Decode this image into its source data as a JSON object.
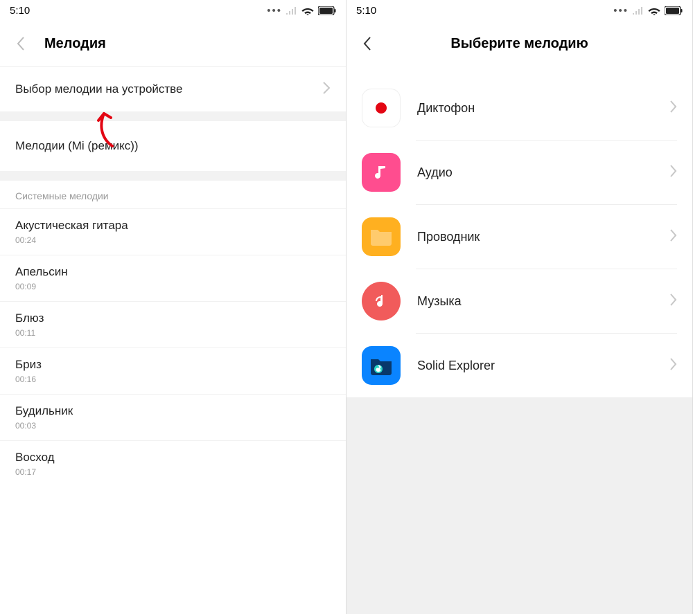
{
  "statusbar": {
    "time": "5:10"
  },
  "left": {
    "title": "Мелодия",
    "select_device": "Выбор мелодии на устройстве",
    "current": "Мелодии (Mi (ремикс))",
    "section_header": "Системные мелодии",
    "ringtones": [
      {
        "name": "Акустическая гитара",
        "duration": "00:24"
      },
      {
        "name": "Апельсин",
        "duration": "00:09"
      },
      {
        "name": "Блюз",
        "duration": "00:11"
      },
      {
        "name": "Бриз",
        "duration": "00:16"
      },
      {
        "name": "Будильник",
        "duration": "00:03"
      },
      {
        "name": "Восход",
        "duration": "00:17"
      }
    ]
  },
  "right": {
    "title": "Выберите мелодию",
    "apps": [
      {
        "label": "Диктофон",
        "icon": "recorder-icon"
      },
      {
        "label": "Аудио",
        "icon": "audio-icon"
      },
      {
        "label": "Проводник",
        "icon": "filemanager-icon"
      },
      {
        "label": "Музыка",
        "icon": "music-icon"
      },
      {
        "label": "Solid Explorer",
        "icon": "solidexplorer-icon"
      }
    ]
  }
}
